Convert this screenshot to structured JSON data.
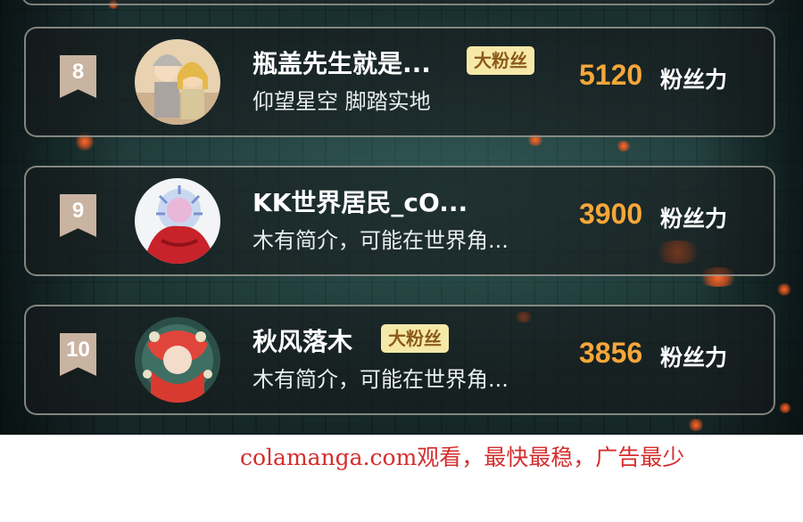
{
  "leaderboard": {
    "rows": [
      {
        "rank": "8",
        "name": "瓶盖先生就是...",
        "badge": "大粉丝",
        "bio": "仰望星空 脚踏实地",
        "score": "5120",
        "unit": "粉丝力"
      },
      {
        "rank": "9",
        "name": "KK世界居民_cO...",
        "badge": "",
        "bio": "木有简介，可能在世界角...",
        "score": "3900",
        "unit": "粉丝力"
      },
      {
        "rank": "10",
        "name": "秋风落木",
        "badge": "大粉丝",
        "bio": "木有简介，可能在世界角...",
        "score": "3856",
        "unit": "粉丝力"
      }
    ]
  },
  "watermark": "colamanga.com观看，最快最稳，广告最少",
  "colors": {
    "score": "#f5a73a",
    "badge_bg": "#f6e9a8",
    "badge_text": "#8a5a1a",
    "rank_ribbon": "#c9b3a1",
    "watermark": "#d42e2e"
  }
}
